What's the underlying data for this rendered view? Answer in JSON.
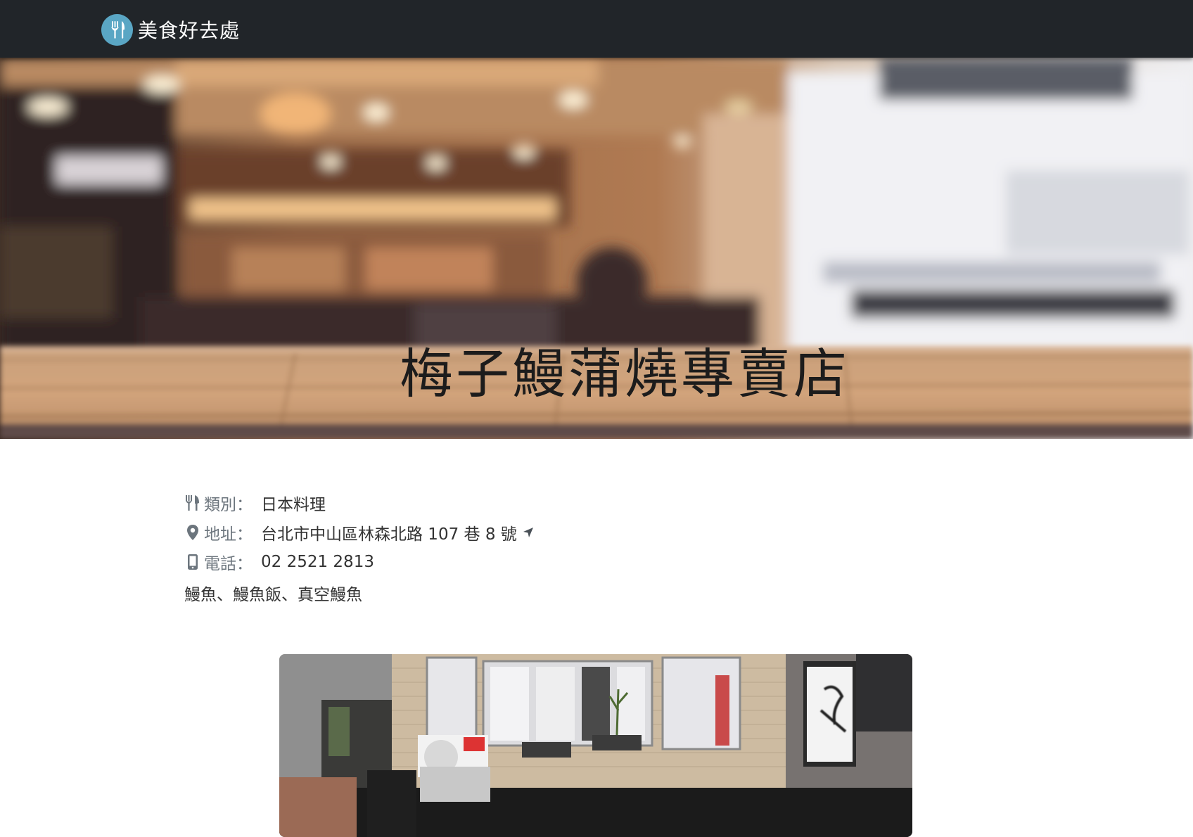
{
  "navbar": {
    "brand_name": "美食好去處",
    "logo_icon": "fork-knife-icon"
  },
  "hero": {
    "title": "梅子鰻蒲燒專賣店"
  },
  "restaurant": {
    "category_label": "類別：",
    "category": "日本料理",
    "address_label": "地址：",
    "address": "台北市中山區林森北路 107 巷 8 號",
    "phone_label": "電話：",
    "phone": "02 2521 2813",
    "description": "鰻魚、鰻魚飯、真空鰻魚"
  },
  "icons": {
    "category": "utensils-icon",
    "address": "map-marker-icon",
    "phone": "mobile-phone-icon",
    "navigate": "location-arrow-icon"
  },
  "colors": {
    "navbar_bg": "#212529",
    "logo_bg": "#5aa6c4",
    "label_gray": "#6c757d"
  }
}
